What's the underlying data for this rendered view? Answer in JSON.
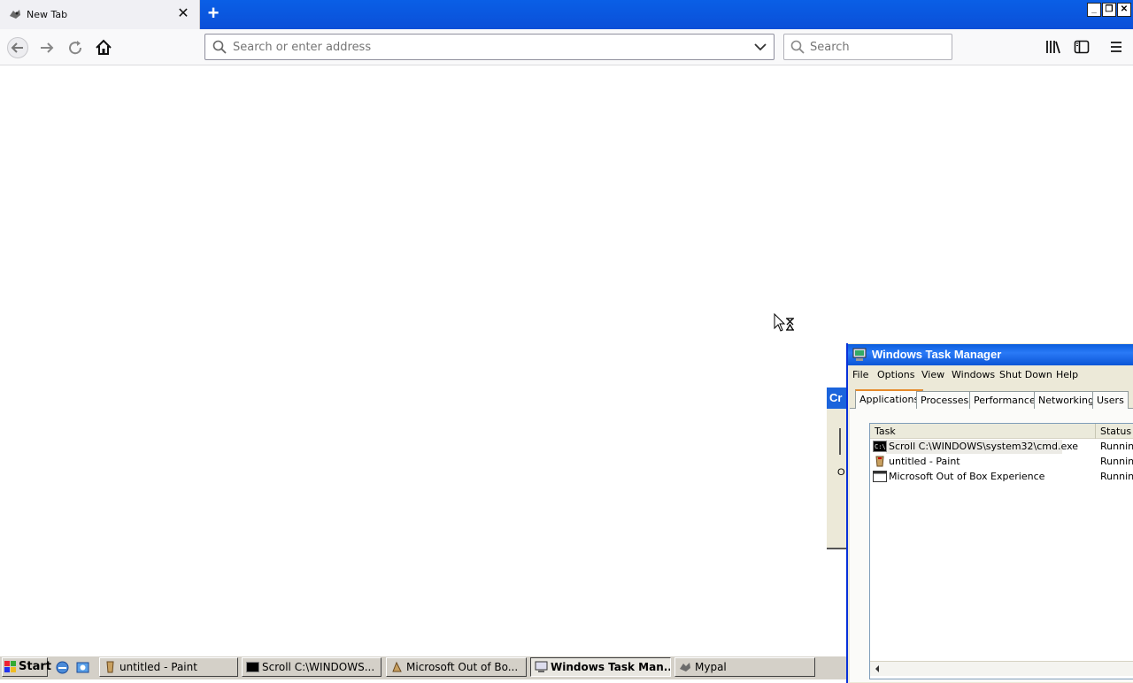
{
  "browser": {
    "tab": {
      "title": "New Tab",
      "close_icon": "close-icon"
    },
    "newtab_icon": "plus-icon",
    "urlbar": {
      "placeholder": "Search or enter address"
    },
    "searchbar": {
      "placeholder": "Search"
    },
    "window_buttons": {
      "minimize": "_",
      "restore": "❐",
      "close": "✕"
    }
  },
  "taskmanager": {
    "title": "Windows Task Manager",
    "menu": [
      "File",
      "Options",
      "View",
      "Windows",
      "Shut Down",
      "Help"
    ],
    "tabs": [
      "Applications",
      "Processes",
      "Performance",
      "Networking",
      "Users"
    ],
    "columns": {
      "task": "Task",
      "status": "Status"
    },
    "rows": [
      {
        "name": "Scroll C:\\WINDOWS\\system32\\cmd.exe",
        "status": "Running"
      },
      {
        "name": "untitled - Paint",
        "status": "Running"
      },
      {
        "name": "Microsoft Out of Box Experience",
        "status": "Running"
      }
    ]
  },
  "background_dialog": {
    "title": "Cr",
    "option": "O"
  },
  "taskbar": {
    "start": "Start",
    "buttons": [
      "untitled - Paint",
      "Scroll C:\\WINDOWS...",
      "Microsoft Out of Bo...",
      "Windows Task Man...",
      "Mypal"
    ]
  },
  "colors": {
    "titlebar": "#0b55d6",
    "tabstrip": "#0a5fe6",
    "taskbar": "#d4d0c8"
  }
}
